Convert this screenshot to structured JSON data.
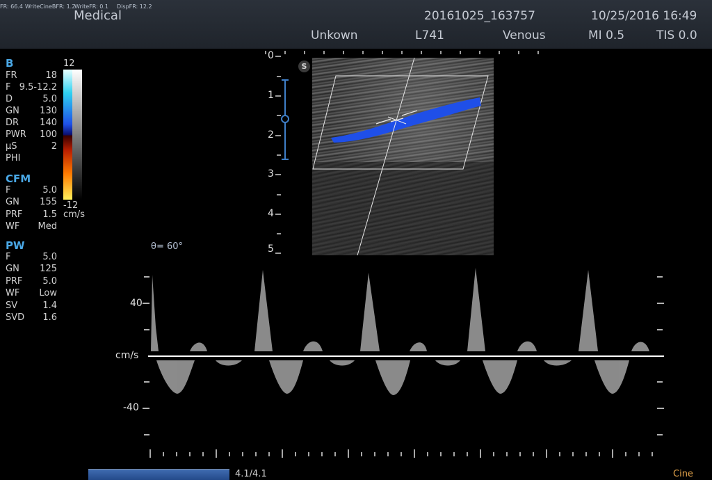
{
  "header": {
    "small_stats": [
      {
        "label": "FR: 66.4"
      },
      {
        "label": "WriteCineBFR: 1.2"
      },
      {
        "label": "WriteFR: 0.1"
      },
      {
        "label": "DispFR: 12.2"
      }
    ],
    "app_title": "Medical",
    "exam_id": "20161025_163757",
    "datetime": "10/25/2016 16:49",
    "patient": "Unkown",
    "probe": "L741",
    "preset": "Venous",
    "mi": "MI 0.5",
    "tis": "TIS 0.0"
  },
  "params": {
    "b": {
      "title": "B",
      "rows": [
        {
          "k": "FR",
          "v": "18"
        },
        {
          "k": "F",
          "v": "9.5-12.2"
        },
        {
          "k": "D",
          "v": "5.0"
        },
        {
          "k": "GN",
          "v": "130"
        },
        {
          "k": "DR",
          "v": "140"
        },
        {
          "k": "PWR",
          "v": "100"
        },
        {
          "k": "µS",
          "v": "2"
        },
        {
          "k": "PHI",
          "v": ""
        }
      ]
    },
    "cfm": {
      "title": "CFM",
      "rows": [
        {
          "k": "F",
          "v": "5.0"
        },
        {
          "k": "GN",
          "v": "155"
        },
        {
          "k": "PRF",
          "v": "1.5"
        },
        {
          "k": "WF",
          "v": "Med"
        }
      ]
    },
    "pw": {
      "title": "PW",
      "rows": [
        {
          "k": "F",
          "v": "5.0"
        },
        {
          "k": "GN",
          "v": "125"
        },
        {
          "k": "PRF",
          "v": "5.0"
        },
        {
          "k": "WF",
          "v": "Low"
        },
        {
          "k": "SV",
          "v": "1.4"
        },
        {
          "k": "SVD",
          "v": "1.6"
        }
      ]
    }
  },
  "color_scale": {
    "top": "12",
    "bottom": "-12",
    "unit": "cm/s"
  },
  "depth_scale": {
    "labels": [
      "0",
      "1",
      "2",
      "3",
      "4",
      "5"
    ]
  },
  "doppler": {
    "angle": "θ= 60°",
    "velocity_labels": {
      "pos": "40",
      "neg": "-40"
    },
    "baseline_unit": "cm/s"
  },
  "cine": {
    "count": "4.1/4.1",
    "button_label": "Cine",
    "progress": 1.0
  },
  "colors": {
    "accent": "#4aa8e6",
    "cine": "#e2a24a",
    "flow": "#1f4fe8"
  },
  "icons": {
    "sample_volume": "sample-gate-icon",
    "scan_badge": "s-badge-icon"
  }
}
